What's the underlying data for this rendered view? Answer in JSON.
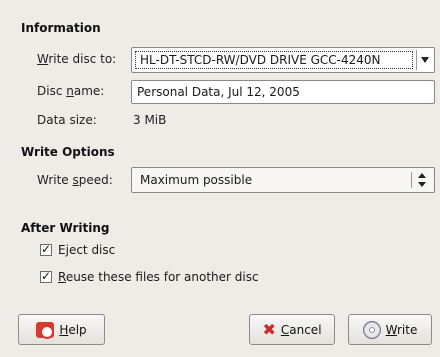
{
  "sections": {
    "information": "Information",
    "write_options": "Write Options",
    "after_writing": "After Writing"
  },
  "info": {
    "write_disc_to": {
      "prefix": "",
      "mnemonic": "W",
      "rest": "rite disc to:"
    },
    "drive_value": "HL-DT-STCD-RW/DVD DRIVE GCC-4240N",
    "disc_name_label": {
      "prefix": "Disc ",
      "mnemonic": "n",
      "rest": "ame:"
    },
    "disc_name_value": "Personal Data, Jul 12, 2005",
    "data_size_label": "Data size:",
    "data_size_value": "3 MiB"
  },
  "write_options": {
    "speed_label": {
      "prefix": "Write ",
      "mnemonic": "s",
      "rest": "peed:"
    },
    "speed_value": "Maximum possible"
  },
  "after": {
    "eject": {
      "prefix": "E",
      "mnemonic": "j",
      "rest": "ect disc",
      "checked": true
    },
    "reuse": {
      "prefix": "",
      "mnemonic": "R",
      "rest": "euse these files for another disc",
      "checked": true
    }
  },
  "buttons": {
    "help": {
      "prefix": "",
      "mnemonic": "H",
      "rest": "elp"
    },
    "cancel": {
      "prefix": "",
      "mnemonic": "C",
      "rest": "ancel"
    },
    "write": {
      "prefix": "",
      "mnemonic": "W",
      "rest": "rite"
    }
  },
  "icons": {
    "help": "help-icon",
    "cancel": "cancel-icon",
    "write": "disc-icon",
    "check": "✓"
  }
}
